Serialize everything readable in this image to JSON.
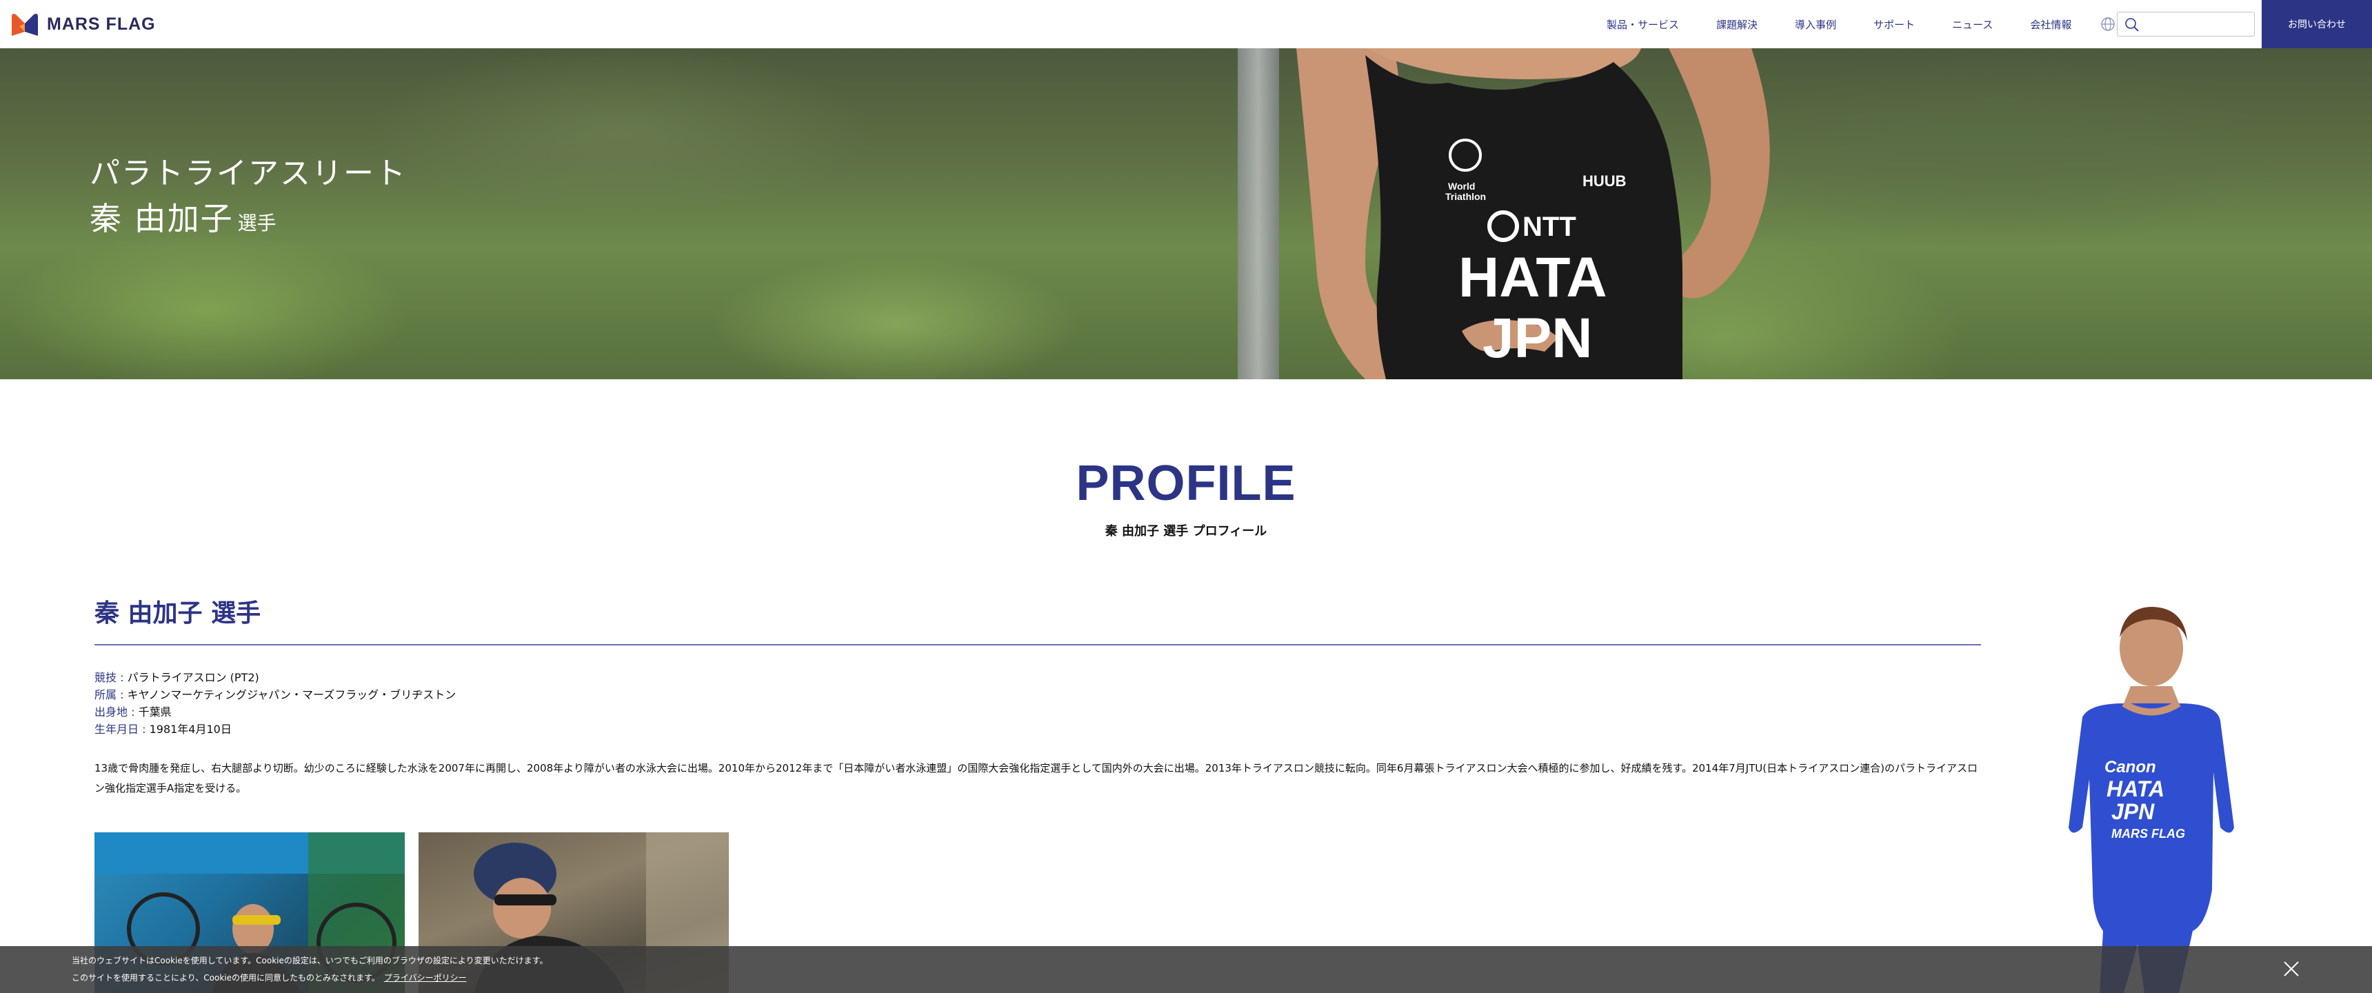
{
  "brand": {
    "name": "MARS FLAG",
    "accent": "#2c3486",
    "logo_orange": "#e8572a",
    "logo_blue": "#2c3486"
  },
  "nav": {
    "items": [
      {
        "label": "製品・サービス"
      },
      {
        "label": "課題解決"
      },
      {
        "label": "導入事例"
      },
      {
        "label": "サポート"
      },
      {
        "label": "ニュース"
      },
      {
        "label": "会社情報"
      }
    ],
    "search_placeholder": "",
    "contact_label": "お問い合わせ"
  },
  "hero": {
    "subtitle": "パラトライアスリート",
    "name": "秦 由加子",
    "name_suffix": "選手"
  },
  "profile": {
    "heading": "PROFILE",
    "caption": "秦 由加子 選手 プロフィール",
    "athlete_name": "秦 由加子 選手",
    "details": [
      {
        "key": "競技 : ",
        "value": "パラトライアスロン (PT2)"
      },
      {
        "key": "所属 : ",
        "value": "キヤノンマーケティングジャパン・マーズフラッグ・ブリヂストン"
      },
      {
        "key": "出身地 : ",
        "value": "千葉県"
      },
      {
        "key": "生年月日 : ",
        "value": "1981年4月10日"
      }
    ],
    "bio": "13歳で骨肉腫を発症し、右大腿部より切断。幼少のころに経験した水泳を2007年に再開し、2008年より障がい者の水泳大会に出場。2010年から2012年まで「日本障がい者水泳連盟」の国際大会強化指定選手として国内外の大会に出場。2013年トライアスロン競技に転向。同年6月幕張トライアスロン大会へ積極的に参加し、好成績を残す。2014年7月JTU(日本トライアスロン連合)のパラトライアスロン強化指定選手A指定を受ける。"
  },
  "cookie": {
    "line1": "当社のウェブサイトはCookieを使用しています。Cookieの設定は、いつでもご利用のブラウザの設定により変更いただけます。",
    "line2": "このサイトを使用することにより、Cookieの使用に同意したものとみなされます。",
    "link": "プライバシーポリシー"
  }
}
